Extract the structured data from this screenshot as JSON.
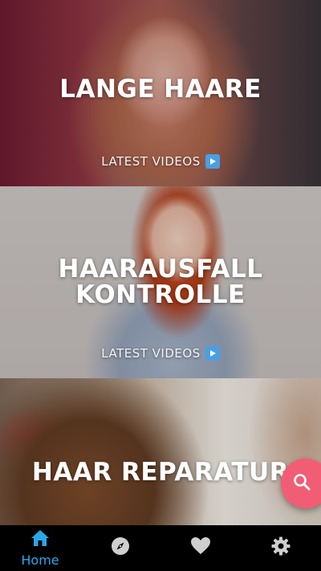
{
  "feed": {
    "cards": [
      {
        "title": "LANGE HAARE",
        "latest_label": "LATEST VIDEOS"
      },
      {
        "title_line1": "HAARAUSFALL",
        "title_line2": "KONTROLLE",
        "latest_label": "LATEST VIDEOS"
      },
      {
        "title": "HAAR REPARATUR"
      }
    ]
  },
  "fab": {
    "icon": "search-icon",
    "color": "#f25d76"
  },
  "tabbar": {
    "active_color": "#29a8e8",
    "inactive_color": "#cfcfcf",
    "tabs": [
      {
        "icon": "home-icon",
        "label": "Home",
        "active": true
      },
      {
        "icon": "compass-icon",
        "active": false
      },
      {
        "icon": "heart-icon",
        "active": false
      },
      {
        "icon": "gear-icon",
        "active": false
      }
    ]
  }
}
